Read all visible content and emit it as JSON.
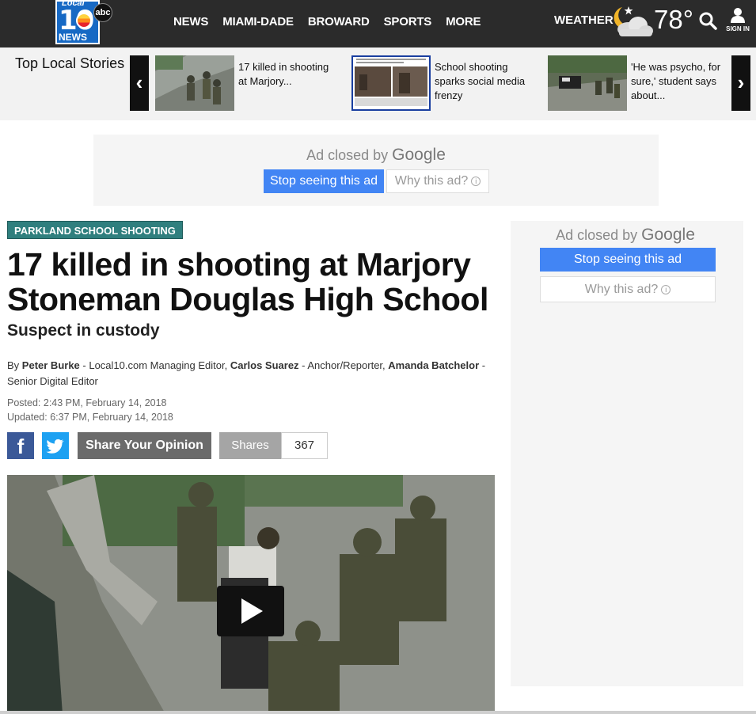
{
  "header": {
    "logo": {
      "small_text": "Local",
      "number": "10",
      "network": "abc",
      "news_text": "NEWS"
    },
    "nav": [
      "NEWS",
      "MIAMI-DADE",
      "BROWARD",
      "SPORTS",
      "MORE"
    ],
    "weather_label": "WEATHER",
    "temperature": "78°",
    "weather_icon": "partly-cloudy-night-icon",
    "search_icon": "search-icon",
    "signin_label": "SIGN IN"
  },
  "top_stories": {
    "title": "Top Local Stories",
    "items": [
      {
        "text": "17 killed in shooting at Marjory..."
      },
      {
        "text": "School shooting sparks social media frenzy"
      },
      {
        "text": "'He was psycho, for sure,' student says about..."
      }
    ]
  },
  "ads": {
    "closed_prefix": "Ad closed by",
    "brand": "Google",
    "stop_label": "Stop seeing this ad",
    "why_label": "Why this ad?"
  },
  "article": {
    "tag": "PARKLAND SCHOOL SHOOTING",
    "headline": "17 killed in shooting at Marjory Stoneman Douglas High School",
    "subhead": "Suspect in custody",
    "byline": {
      "by": "By",
      "authors": [
        {
          "name": "Peter Burke",
          "role": " - Local10.com Managing Editor, "
        },
        {
          "name": "Carlos Suarez",
          "role": " - Anchor/Reporter, "
        },
        {
          "name": "Amanda Batchelor",
          "role": " - Senior Digital Editor"
        }
      ]
    },
    "posted": "Posted: 2:43 PM, February 14, 2018",
    "updated": "Updated: 6:37 PM, February 14, 2018",
    "share": {
      "facebook_icon": "facebook-icon",
      "twitter_icon": "twitter-icon",
      "opinion_label": "Share Your Opinion",
      "shares_label": "Shares",
      "shares_count": "367"
    },
    "video_icon": "play-icon"
  }
}
